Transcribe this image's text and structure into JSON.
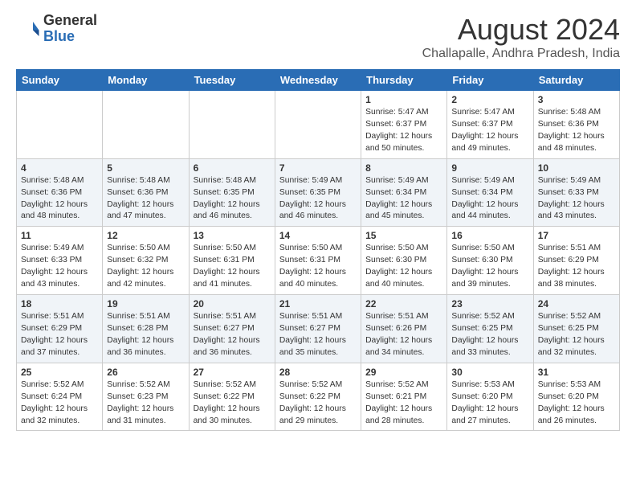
{
  "logo": {
    "general": "General",
    "blue": "Blue"
  },
  "title": "August 2024",
  "subtitle": "Challapalle, Andhra Pradesh, India",
  "weekdays": [
    "Sunday",
    "Monday",
    "Tuesday",
    "Wednesday",
    "Thursday",
    "Friday",
    "Saturday"
  ],
  "weeks": [
    [
      {
        "day": "",
        "info": ""
      },
      {
        "day": "",
        "info": ""
      },
      {
        "day": "",
        "info": ""
      },
      {
        "day": "",
        "info": ""
      },
      {
        "day": "1",
        "info": "Sunrise: 5:47 AM\nSunset: 6:37 PM\nDaylight: 12 hours\nand 50 minutes."
      },
      {
        "day": "2",
        "info": "Sunrise: 5:47 AM\nSunset: 6:37 PM\nDaylight: 12 hours\nand 49 minutes."
      },
      {
        "day": "3",
        "info": "Sunrise: 5:48 AM\nSunset: 6:36 PM\nDaylight: 12 hours\nand 48 minutes."
      }
    ],
    [
      {
        "day": "4",
        "info": "Sunrise: 5:48 AM\nSunset: 6:36 PM\nDaylight: 12 hours\nand 48 minutes."
      },
      {
        "day": "5",
        "info": "Sunrise: 5:48 AM\nSunset: 6:36 PM\nDaylight: 12 hours\nand 47 minutes."
      },
      {
        "day": "6",
        "info": "Sunrise: 5:48 AM\nSunset: 6:35 PM\nDaylight: 12 hours\nand 46 minutes."
      },
      {
        "day": "7",
        "info": "Sunrise: 5:49 AM\nSunset: 6:35 PM\nDaylight: 12 hours\nand 46 minutes."
      },
      {
        "day": "8",
        "info": "Sunrise: 5:49 AM\nSunset: 6:34 PM\nDaylight: 12 hours\nand 45 minutes."
      },
      {
        "day": "9",
        "info": "Sunrise: 5:49 AM\nSunset: 6:34 PM\nDaylight: 12 hours\nand 44 minutes."
      },
      {
        "day": "10",
        "info": "Sunrise: 5:49 AM\nSunset: 6:33 PM\nDaylight: 12 hours\nand 43 minutes."
      }
    ],
    [
      {
        "day": "11",
        "info": "Sunrise: 5:49 AM\nSunset: 6:33 PM\nDaylight: 12 hours\nand 43 minutes."
      },
      {
        "day": "12",
        "info": "Sunrise: 5:50 AM\nSunset: 6:32 PM\nDaylight: 12 hours\nand 42 minutes."
      },
      {
        "day": "13",
        "info": "Sunrise: 5:50 AM\nSunset: 6:31 PM\nDaylight: 12 hours\nand 41 minutes."
      },
      {
        "day": "14",
        "info": "Sunrise: 5:50 AM\nSunset: 6:31 PM\nDaylight: 12 hours\nand 40 minutes."
      },
      {
        "day": "15",
        "info": "Sunrise: 5:50 AM\nSunset: 6:30 PM\nDaylight: 12 hours\nand 40 minutes."
      },
      {
        "day": "16",
        "info": "Sunrise: 5:50 AM\nSunset: 6:30 PM\nDaylight: 12 hours\nand 39 minutes."
      },
      {
        "day": "17",
        "info": "Sunrise: 5:51 AM\nSunset: 6:29 PM\nDaylight: 12 hours\nand 38 minutes."
      }
    ],
    [
      {
        "day": "18",
        "info": "Sunrise: 5:51 AM\nSunset: 6:29 PM\nDaylight: 12 hours\nand 37 minutes."
      },
      {
        "day": "19",
        "info": "Sunrise: 5:51 AM\nSunset: 6:28 PM\nDaylight: 12 hours\nand 36 minutes."
      },
      {
        "day": "20",
        "info": "Sunrise: 5:51 AM\nSunset: 6:27 PM\nDaylight: 12 hours\nand 36 minutes."
      },
      {
        "day": "21",
        "info": "Sunrise: 5:51 AM\nSunset: 6:27 PM\nDaylight: 12 hours\nand 35 minutes."
      },
      {
        "day": "22",
        "info": "Sunrise: 5:51 AM\nSunset: 6:26 PM\nDaylight: 12 hours\nand 34 minutes."
      },
      {
        "day": "23",
        "info": "Sunrise: 5:52 AM\nSunset: 6:25 PM\nDaylight: 12 hours\nand 33 minutes."
      },
      {
        "day": "24",
        "info": "Sunrise: 5:52 AM\nSunset: 6:25 PM\nDaylight: 12 hours\nand 32 minutes."
      }
    ],
    [
      {
        "day": "25",
        "info": "Sunrise: 5:52 AM\nSunset: 6:24 PM\nDaylight: 12 hours\nand 32 minutes."
      },
      {
        "day": "26",
        "info": "Sunrise: 5:52 AM\nSunset: 6:23 PM\nDaylight: 12 hours\nand 31 minutes."
      },
      {
        "day": "27",
        "info": "Sunrise: 5:52 AM\nSunset: 6:22 PM\nDaylight: 12 hours\nand 30 minutes."
      },
      {
        "day": "28",
        "info": "Sunrise: 5:52 AM\nSunset: 6:22 PM\nDaylight: 12 hours\nand 29 minutes."
      },
      {
        "day": "29",
        "info": "Sunrise: 5:52 AM\nSunset: 6:21 PM\nDaylight: 12 hours\nand 28 minutes."
      },
      {
        "day": "30",
        "info": "Sunrise: 5:53 AM\nSunset: 6:20 PM\nDaylight: 12 hours\nand 27 minutes."
      },
      {
        "day": "31",
        "info": "Sunrise: 5:53 AM\nSunset: 6:20 PM\nDaylight: 12 hours\nand 26 minutes."
      }
    ]
  ]
}
